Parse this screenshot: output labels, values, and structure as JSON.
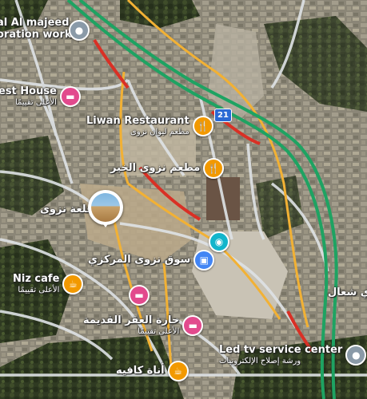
{
  "map": {
    "route_number": "21",
    "colors": {
      "traffic_red": "#d93025",
      "traffic_green": "#1ea362",
      "road_yellow": "#f2b134",
      "road_white": "#dfe3e6"
    }
  },
  "pois": [
    {
      "id": "al-majeed",
      "name_line1": "al Al majeed",
      "name_line2": "oration work",
      "sub": "",
      "icon": "generic-pin-icon",
      "category": "generic"
    },
    {
      "id": "guest-house",
      "name": "est House",
      "sub": "الأعلى تقييمًا",
      "icon": "hotel-icon",
      "category": "hotel"
    },
    {
      "id": "liwan",
      "name": "Liwan Restaurant",
      "sub": "مطعم ليوان نزوى",
      "icon": "restaurant-icon",
      "category": "food"
    },
    {
      "id": "nizwa-khair",
      "name": "مطعم نزوى الخير",
      "sub": "",
      "icon": "restaurant-icon",
      "category": "food"
    },
    {
      "id": "nizwa-fort",
      "name": "قلعة نزوى",
      "sub": "",
      "icon": "photo-thumbnail",
      "category": "landmark"
    },
    {
      "id": "photo-spot",
      "name": "",
      "sub": "",
      "icon": "camera-icon",
      "category": "photo"
    },
    {
      "id": "central-souq",
      "name": "سوق نزوى المركزي",
      "sub": "",
      "icon": "shopping-bag-icon",
      "category": "shop"
    },
    {
      "id": "niz-cafe",
      "name": "Niz cafe",
      "sub": "الأعلى تقييمًا",
      "icon": "cafe-icon",
      "category": "food"
    },
    {
      "id": "hotel-2",
      "name": "",
      "sub": "",
      "icon": "hotel-icon",
      "category": "hotel"
    },
    {
      "id": "haret-al-aqr",
      "name": "حارة العقر القديمة",
      "sub": "الأعلى تقييمًا",
      "icon": "hotel-icon",
      "category": "hotel"
    },
    {
      "id": "shaal",
      "name": "ي شعال",
      "sub": "",
      "icon": "none",
      "category": "text"
    },
    {
      "id": "led-tv",
      "name": "Led tv service center",
      "sub": "ورشة إصلاح الإلكترونيات",
      "icon": "generic-pin-icon",
      "category": "generic"
    },
    {
      "id": "ana-cafe",
      "name": "أناة كافيه",
      "sub": "",
      "icon": "cafe-icon",
      "category": "food"
    }
  ]
}
